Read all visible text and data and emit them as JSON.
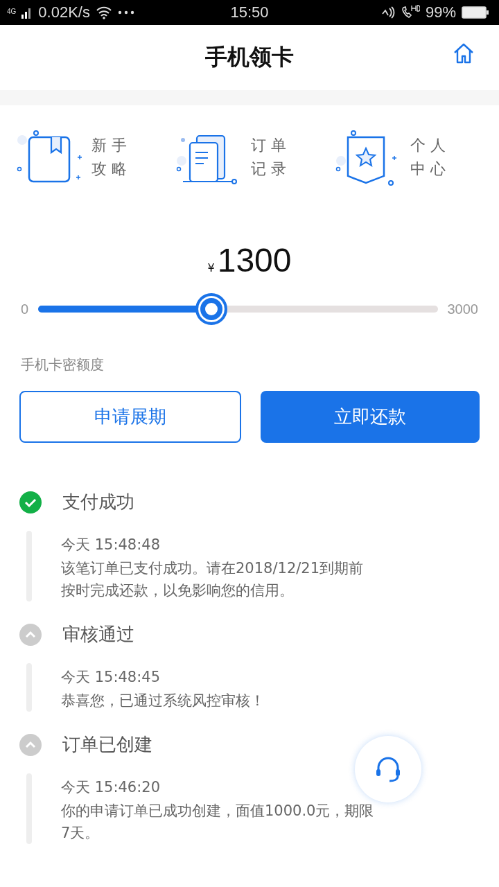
{
  "status_bar": {
    "network": "4G",
    "speed": "0.02K/s",
    "time": "15:50",
    "battery": "99%"
  },
  "header": {
    "title": "手机领卡"
  },
  "shortcuts": [
    {
      "kind": "book",
      "line1": "新 手",
      "line2": "攻 略"
    },
    {
      "kind": "docs",
      "line1": "订 单",
      "line2": "记 录"
    },
    {
      "kind": "badge",
      "line1": "个 人",
      "line2": "中 心"
    }
  ],
  "amount": {
    "currency": "¥",
    "value": "1300"
  },
  "slider": {
    "min": "0",
    "max": "3000",
    "level": 0.433
  },
  "limit_label": "手机卡密额度",
  "buttons": [
    {
      "label": "申请展期",
      "kind": "outline"
    },
    {
      "label": "立即还款",
      "kind": "primary"
    }
  ],
  "timeline": [
    {
      "kind": "done",
      "title": "支付成功",
      "time": "今天 15:48:48",
      "text": "该笔订单已支付成功。请在2018/12/21到期前按时完成还款，以免影响您的信用。"
    },
    {
      "kind": "pending",
      "title": "审核通过",
      "time": "今天 15:48:45",
      "text": "恭喜您，已通过系统风控审核！"
    },
    {
      "kind": "pending",
      "title": "订单已创建",
      "time": "今天 15:46:20",
      "text": "你的申请订单已成功创建，面值1000.0元，期限7天。"
    }
  ]
}
